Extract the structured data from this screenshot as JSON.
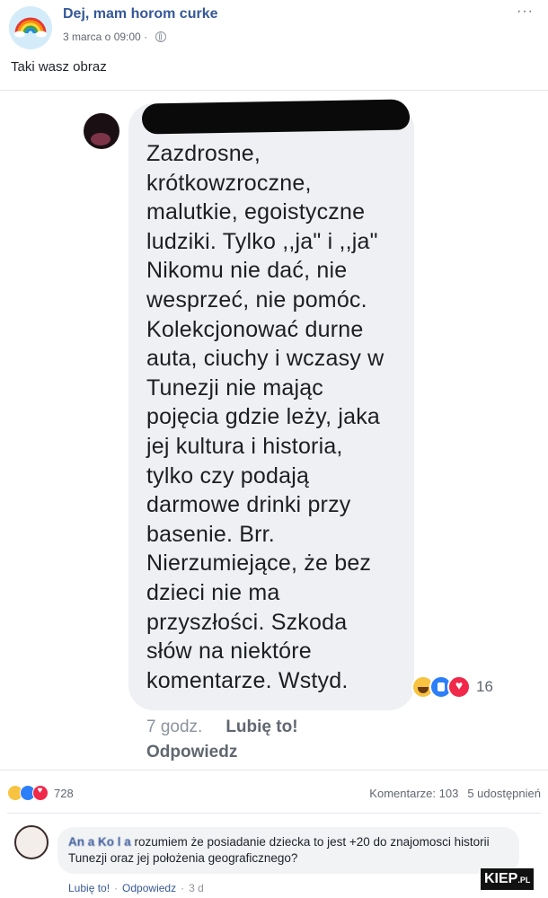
{
  "post": {
    "page_name": "Dej, mam horom curke",
    "date": "3 marca o 09:00",
    "separator": "·",
    "more_options": "···",
    "text": "Taki wasz obraz"
  },
  "screenshot": {
    "comment_lines": [
      "Zazdrosne,",
      "krótkowzroczne,",
      "malutkie, egoistyczne",
      "ludziki. Tylko ,,ja\" i ,,ja\"",
      "Nikomu nie  dać, nie",
      "wesprzeć, nie pomóc.",
      "Kolekcjonować durne",
      "auta, ciuchy i wczasy w",
      "Tunezji nie mając",
      "pojęcia gdzie leży, jaka",
      "jej kultura i historia,",
      "tylko czy podają",
      "darmowe drinki przy",
      "basenie. Brr.",
      "Nierzumiejące, że bez",
      "dzieci nie ma",
      "przyszłości. Szkoda",
      "słów na niektóre",
      "komentarze. Wstyd."
    ],
    "reaction_count": "16",
    "time": "7 godz.",
    "like": "Lubię to!",
    "reply": "Odpowiedz"
  },
  "footer": {
    "reactions_total": "728",
    "comments": "Komentarze: 103",
    "shares": "5 udostępnień"
  },
  "comment": {
    "author": "An   a Ko   l   a",
    "text": "rozumiem że posiadanie dziecka to jest +20 do znajomosci historii Tunezji oraz jej położenia geograficznego?",
    "like": "Lubię to!",
    "reply": "Odpowiedz",
    "time": "3 d"
  },
  "watermark": {
    "main": "KIEP",
    "suffix": ".PL"
  },
  "icons": [
    "rainbow-avatar",
    "globe-icon",
    "haha-icon",
    "like-icon",
    "love-icon"
  ]
}
